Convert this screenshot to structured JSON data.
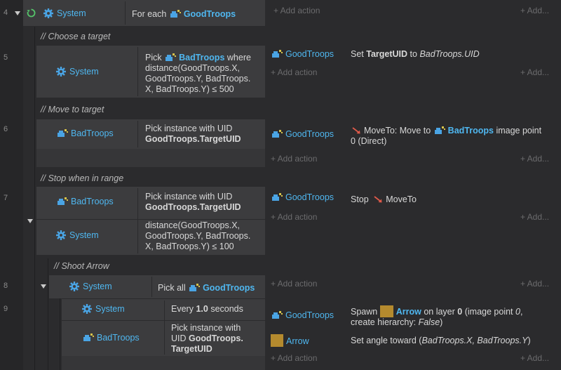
{
  "line_numbers": [
    "4",
    "5",
    "6",
    "7",
    "8",
    "9"
  ],
  "common": {
    "add_action": "+ Add action",
    "add_more": "+ Add..."
  },
  "comments": {
    "choose_target": "Choose a target",
    "move_to_target": "Move to target",
    "stop_in_range": "Stop when in range",
    "shoot_arrow": "Shoot Arrow"
  },
  "objects": {
    "system": "System",
    "good_troops": "GoodTroops",
    "bad_troops": "BadTroops",
    "arrow": "Arrow"
  },
  "ev4": {
    "cond_prefix": "For each"
  },
  "ev5": {
    "cond_prefix": "Pick",
    "cond_line1_suffix": "where",
    "cond_line2": "distance(GoodTroops.X,",
    "cond_line3": "GoodTroops.Y, BadTroops.",
    "cond_line4": "X, BadTroops.Y) ≤ 500",
    "act_prefix": "Set",
    "act_var": "TargetUID",
    "act_mid": "to",
    "act_value": "BadTroops.UID"
  },
  "ev6": {
    "cond_line1": "Pick instance with UID",
    "cond_line2": "GoodTroops.TargetUID",
    "act_prefix": "MoveTo: Move to",
    "act_suffix": "image point",
    "act_line2": "0 (Direct)"
  },
  "ev7": {
    "cond1_line1": "Pick instance with UID",
    "cond1_line2": "GoodTroops.TargetUID",
    "cond2_line1": "distance(GoodTroops.X,",
    "cond2_line2": "GoodTroops.Y, BadTroops.",
    "cond2_line3": "X, BadTroops.Y) ≤ 100",
    "act_stop": "Stop",
    "act_moveto": "MoveTo"
  },
  "ev8": {
    "cond_prefix": "Pick all"
  },
  "ev9": {
    "cond1_prefix": "Every",
    "cond1_value": "1.0",
    "cond1_suffix": "seconds",
    "cond2_line1": "Pick instance with",
    "cond2_line2_prefix": "UID",
    "cond2_line2_bold": "GoodTroops.",
    "cond2_line3": "TargetUID",
    "act1_prefix": "Spawn",
    "act1_mid": "on layer",
    "act1_layer": "0",
    "act1_paren": "(image point",
    "act1_point": "0",
    "act1_line2_prefix": "create hierarchy:",
    "act1_line2_value": "False",
    "act1_line2_close": ")",
    "act2_prefix": "Set angle toward (",
    "act2_args": "BadTroops.X, BadTroops.Y",
    "act2_close": ")"
  }
}
